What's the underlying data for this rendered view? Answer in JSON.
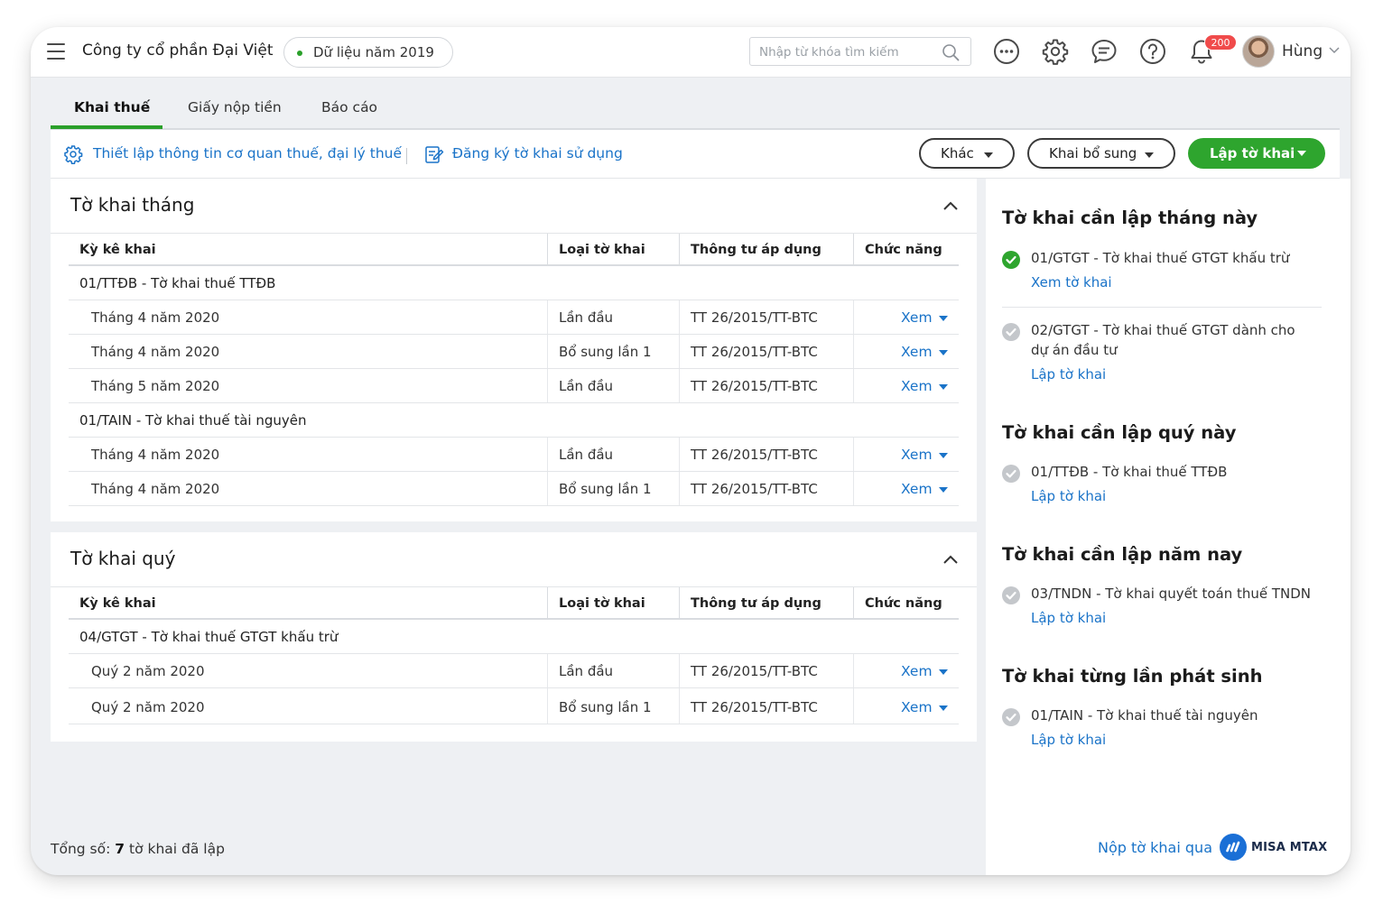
{
  "header": {
    "company": "Công ty cổ phần Đại Việt",
    "data_year": "Dữ liệu năm 2019",
    "search_placeholder": "Nhập từ khóa tìm kiếm",
    "notification_count": "200",
    "user_name": "Hùng"
  },
  "tabs": [
    {
      "label": "Khai thuế",
      "active": true
    },
    {
      "label": "Giấy nộp tiền",
      "active": false
    },
    {
      "label": "Báo cáo",
      "active": false
    }
  ],
  "actions": {
    "setup_link": "Thiết lập thông tin cơ quan thuế, đại lý thuế",
    "register_link": "Đăng ký tờ khai sử dụng",
    "other_button": "Khác",
    "supplement_button": "Khai bổ sung",
    "create_button": "Lập tờ khai"
  },
  "columns": [
    "Kỳ kê khai",
    "Loại tờ khai",
    "Thông tư áp dụng",
    "Chức năng"
  ],
  "monthly": {
    "title": "Tờ khai tháng",
    "groups": [
      {
        "name": "01/TTĐB - Tờ khai thuế TTĐB",
        "rows": [
          {
            "period": "Tháng 4 năm 2020",
            "type": "Lần đầu",
            "circular": "TT 26/2015/TT-BTC",
            "action": "Xem"
          },
          {
            "period": "Tháng 4 năm 2020",
            "type": "Bổ sung lần 1",
            "circular": "TT 26/2015/TT-BTC",
            "action": "Xem"
          },
          {
            "period": "Tháng 5 năm 2020",
            "type": "Lần đầu",
            "circular": "TT 26/2015/TT-BTC",
            "action": "Xem"
          }
        ]
      },
      {
        "name": "01/TAIN - Tờ khai thuế tài nguyên",
        "rows": [
          {
            "period": "Tháng 4 năm 2020",
            "type": "Lần đầu",
            "circular": "TT 26/2015/TT-BTC",
            "action": "Xem"
          },
          {
            "period": "Tháng 4 năm 2020",
            "type": "Bổ sung lần 1",
            "circular": "TT 26/2015/TT-BTC",
            "action": "Xem"
          }
        ]
      }
    ]
  },
  "quarterly": {
    "title": "Tờ khai quý",
    "groups": [
      {
        "name": "04/GTGT - Tờ khai thuế GTGT khấu trừ",
        "rows": [
          {
            "period": "Quý 2 năm 2020",
            "type": "Lần đầu",
            "circular": "TT 26/2015/TT-BTC",
            "action": "Xem"
          },
          {
            "period": "Quý 2 năm 2020",
            "type": "Bổ sung lần 1",
            "circular": "TT 26/2015/TT-BTC",
            "action": "Xem"
          }
        ]
      }
    ]
  },
  "sidebar": {
    "this_month": {
      "title": "Tờ khai cần lập tháng này",
      "items": [
        {
          "label": "01/GTGT - Tờ khai thuế GTGT khấu trừ",
          "link": "Xem tờ khai",
          "done": true
        },
        {
          "label": "02/GTGT - Tờ khai thuế GTGT dành cho dự án đầu tư",
          "link": "Lập tờ khai",
          "done": false
        }
      ]
    },
    "this_quarter": {
      "title": "Tờ khai cần lập quý này",
      "items": [
        {
          "label": "01/TTĐB - Tờ khai thuế TTĐB",
          "link": "Lập tờ khai",
          "done": false
        }
      ]
    },
    "this_year": {
      "title": "Tờ khai cần lập năm nay",
      "items": [
        {
          "label": "03/TNDN - Tờ khai quyết toán thuế TNDN",
          "link": "Lập tờ khai",
          "done": false
        }
      ]
    },
    "each_time": {
      "title": "Tờ khai từng lần phát sinh",
      "items": [
        {
          "label": "01/TAIN - Tờ khai thuế tài nguyên",
          "link": "Lập tờ khai",
          "done": false
        }
      ]
    }
  },
  "footer": {
    "total_prefix": "Tổng số:",
    "total_count": "7",
    "total_suffix": "tờ khai đã lập",
    "submit_via": "Nộp tờ khai qua",
    "brand": "MISA MTAX"
  },
  "colors": {
    "accent_green": "#2ea52e",
    "link_blue": "#1a73c8",
    "badge_red": "#f04b4b"
  },
  "icons": [
    "menu-icon",
    "search-icon",
    "more-icon",
    "gear-icon",
    "chat-icon",
    "help-icon",
    "bell-icon",
    "settings-link-icon",
    "edit-doc-icon",
    "chevron-up-icon",
    "check-circle-icon",
    "misa-logo-icon"
  ]
}
